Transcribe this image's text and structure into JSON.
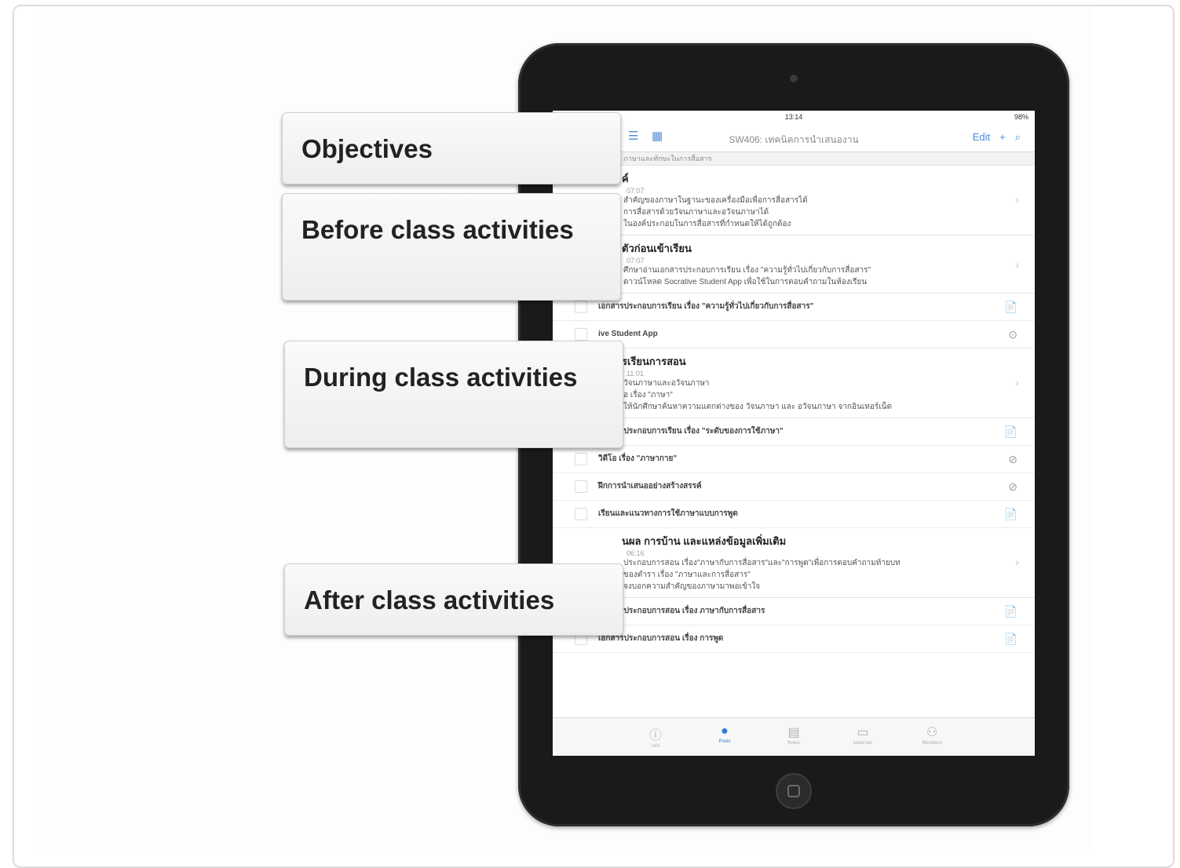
{
  "ipad": {
    "status": {
      "time": "13:14",
      "battery": "98%"
    },
    "nav": {
      "title": "SW406: เทคนิคการนำเสนองาน",
      "edit_label": "Edit"
    },
    "breadcrumb": "ภาษาและทักษะในการสื่อสาร",
    "sections": [
      {
        "title": "ค์",
        "time": "07:07",
        "lines": [
          "สำคัญของภาษาในฐานะของเครื่องมือเพื่อการสื่อสารได้",
          "การสื่อสารด้วยวัจนภาษาและอวัจนภาษาได้",
          "ในองค์ประกอบในการสื่อสารที่กำหนดให้ได้ถูกต้อง"
        ]
      },
      {
        "title": "ตัวก่อนเข้าเรียน",
        "time": "07:07",
        "lines": [
          "ศึกษาอ่านเอกสารประกอบการเรียน เรื่อง \"ความรู้ทั่วไปเกี่ยวกับการสื่อสาร\"",
          "ดาวน์โหลด Socrative Student App เพื่อใช้ในการตอบคำถามในห้องเรียน"
        ]
      },
      {
        "title": "รเรียนการสอน",
        "time": "11:01",
        "lines": [
          "วัจนภาษาและอวัจนภาษา",
          "อ เรื่อง \"ภาษา\"",
          "ให้นักศึกษาค้นหาความแตกต่างของ วัจนภาษา และ อวัจนภาษา จากอินเทอร์เน็ต"
        ]
      },
      {
        "title": "นผล การบ้าน และแหล่งข้อมูลเพิ่มเติม",
        "time": "06:16",
        "lines": [
          "ประกอบการสอน เรื่อง\"ภาษากับการสื่อสาร\"และ\"การพูด\"เพื่อการตอบคำถามท้ายบท",
          "ของตำรา เรื่อง \"ภาษาและการสื่อสาร\"",
          "จงบอกความสำคัญของภาษามาพอเข้าใจ"
        ]
      }
    ],
    "items_a": [
      {
        "label": "เอกสารประกอบการเรียน เรื่อง \"ความรู้ทั่วไปเกี่ยวกับการสื่อสาร\"",
        "icon": "📄"
      },
      {
        "label": "ive Student App",
        "icon": "⊙"
      }
    ],
    "items_b": [
      {
        "label": "เอกสารประกอบการเรียน เรื่อง \"ระดับของการใช้ภาษา\"",
        "icon": "📄"
      },
      {
        "label": "วิดีโอ เรื่อง \"ภาษากาย\"",
        "icon": "⊘"
      },
      {
        "label": "ฝึกการนำเสนออย่างสร้างสรรค์",
        "icon": "⊘"
      },
      {
        "label": "เรียนและแนวทางการใช้ภาษาแบบการพูด",
        "icon": "📄"
      }
    ],
    "items_c": [
      {
        "label": "เอกสารประกอบการสอน เรื่อง ภาษากับการสื่อสาร",
        "icon": "📄"
      },
      {
        "label": "เอกสารประกอบการสอน เรื่อง การพูด",
        "icon": "📄"
      }
    ],
    "tabs": [
      {
        "label": "Info",
        "icon": "ⓘ"
      },
      {
        "label": "Posts",
        "icon": "●"
      },
      {
        "label": "Notes",
        "icon": "▤"
      },
      {
        "label": "Materials",
        "icon": "▭"
      },
      {
        "label": "Members",
        "icon": "⚇"
      }
    ]
  },
  "callouts": {
    "objectives": "Objectives",
    "before": "Before class activities",
    "during": "During class activities",
    "after": "After class activities"
  }
}
